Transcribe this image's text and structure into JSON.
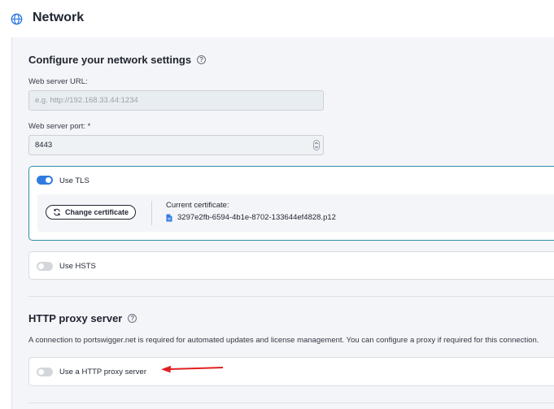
{
  "header": {
    "title": "Network",
    "icon": "globe-icon"
  },
  "network_settings": {
    "title": "Configure your network settings",
    "web_server_url": {
      "label": "Web server URL:",
      "value": "",
      "placeholder": "e.g. http://192.168.33.44:1234"
    },
    "web_server_port": {
      "label": "Web server port: *",
      "value": "8443"
    },
    "tls": {
      "label": "Use TLS",
      "enabled": true,
      "change_certificate_label": "Change certificate",
      "current_certificate_label": "Current certificate:",
      "certificate_file": "3297e2fb-6594-4b1e-8702-133644ef4828.p12"
    },
    "hsts": {
      "label": "Use HSTS",
      "enabled": false
    }
  },
  "proxy": {
    "title": "HTTP proxy server",
    "description": "A connection to portswigger.net is required for automated updates and license management. You can configure a proxy if required for this connection.",
    "toggle_label": "Use a HTTP proxy server",
    "enabled": false
  },
  "colors": {
    "accent": "#2f7be0",
    "tls_border": "#2e8fa8",
    "annotation_arrow": "#e02020",
    "panel_bg": "#f4f5f8"
  }
}
